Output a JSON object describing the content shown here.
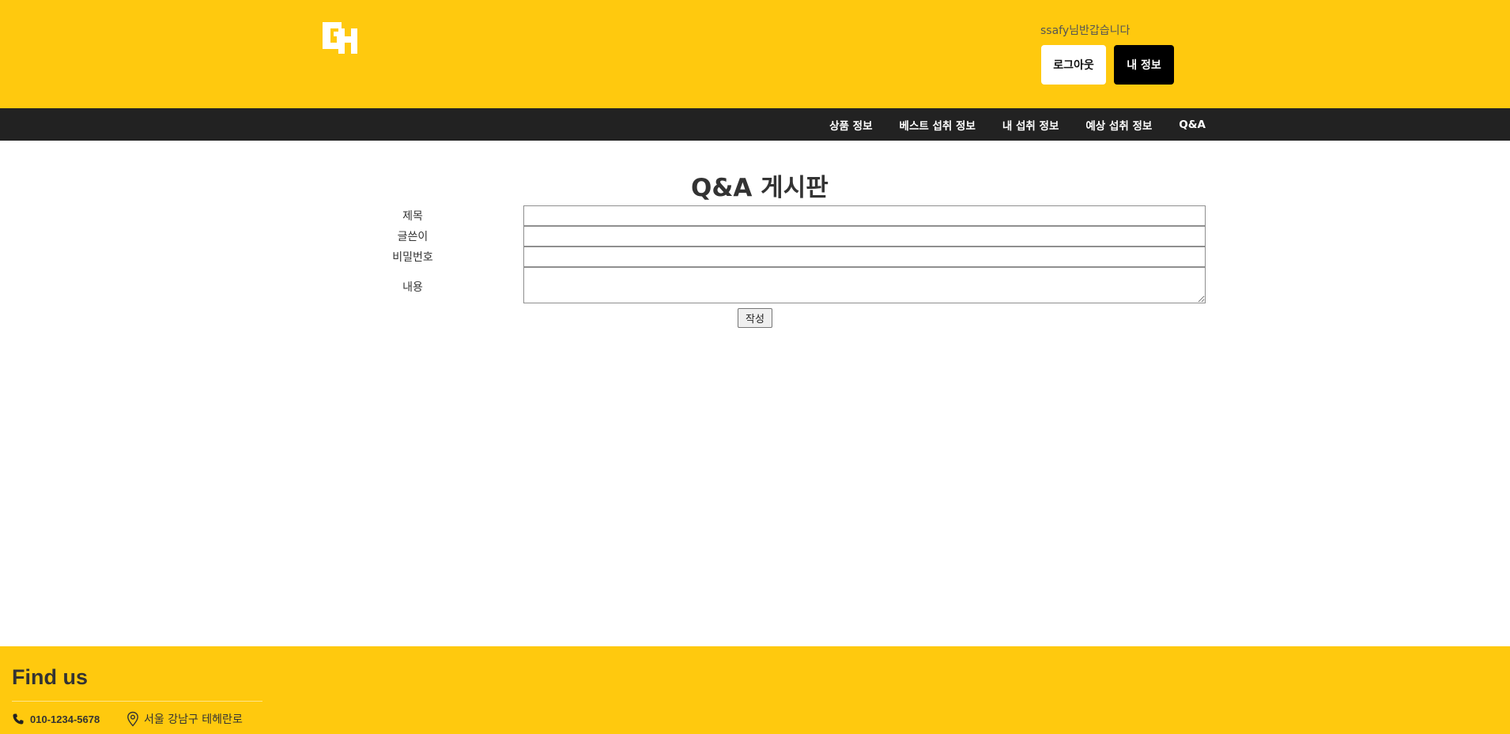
{
  "header": {
    "logo_text": "GH",
    "greeting": "ssafy님반갑습니다",
    "logout_label": "로그아웃",
    "myinfo_label": "내 정보",
    "background_color": "#ffc90e"
  },
  "nav": {
    "items": [
      {
        "label": "상품 정보"
      },
      {
        "label": "베스트 섭취 정보"
      },
      {
        "label": "내 섭취 정보"
      },
      {
        "label": "예상 섭취 정보"
      },
      {
        "label": "Q&A"
      }
    ],
    "background_color": "#222222"
  },
  "main": {
    "title": "Q&A 게시판",
    "form": {
      "title_label": "제목",
      "title_value": "",
      "author_label": "글쓴이",
      "author_value": "",
      "password_label": "비밀번호",
      "password_value": "",
      "content_label": "내용",
      "content_value": "",
      "submit_label": "작성"
    }
  },
  "footer": {
    "title": "Find us",
    "phone": "010-1234-5678",
    "phone_icon": "phone-icon",
    "address": "서울 강남구 테헤란로",
    "address_icon": "map-pin-icon",
    "background_color": "#ffc90e"
  }
}
